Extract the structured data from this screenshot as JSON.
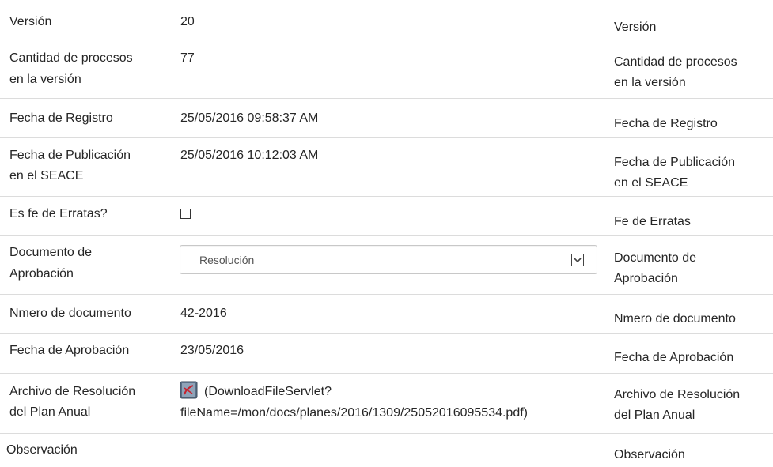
{
  "rows": {
    "version": {
      "label": "Versión",
      "value": "20",
      "right_label": "Versión"
    },
    "procesos": {
      "label_1": "Cantidad de procesos",
      "label_2": "en la versión",
      "value": "77",
      "right_label_1": "Cantidad de procesos",
      "right_label_2": "en la versión"
    },
    "registro": {
      "label": "Fecha de Registro",
      "value": "25/05/2016 09:58:37 AM",
      "right_label": "Fecha de Registro"
    },
    "publicacion": {
      "label_1": "Fecha de Publicación",
      "label_2": "en el SEACE",
      "value": "25/05/2016 10:12:03 AM",
      "right_label_1": "Fecha de Publicación",
      "right_label_2": "en el SEACE"
    },
    "erratas": {
      "label": "Es fe de Erratas?",
      "checked": false,
      "right_label": "Fe de Erratas"
    },
    "documento": {
      "label_1": "Documento de",
      "label_2": "Aprobación",
      "selected": "Resolución",
      "right_label_1": "Documento de",
      "right_label_2": "Aprobación"
    },
    "numero": {
      "label": "Nmero de documento",
      "value": "42-2016",
      "right_label": "Nmero de documento"
    },
    "aprobacion": {
      "label": "Fecha de Aprobación",
      "value": "23/05/2016",
      "right_label": "Fecha de Aprobación"
    },
    "archivo": {
      "label_1": "Archivo de Resolución",
      "label_2": "del Plan Anual",
      "link_1": "(DownloadFileServlet?",
      "link_2": "fileName=/mon/docs/planes/2016/1309/25052016095534.pdf)",
      "right_label_1": "Archivo de Resolución",
      "right_label_2": "del Plan Anual",
      "icon": "pdf-file-icon"
    },
    "observacion": {
      "label": "Observación",
      "right_label": "Observación"
    }
  }
}
